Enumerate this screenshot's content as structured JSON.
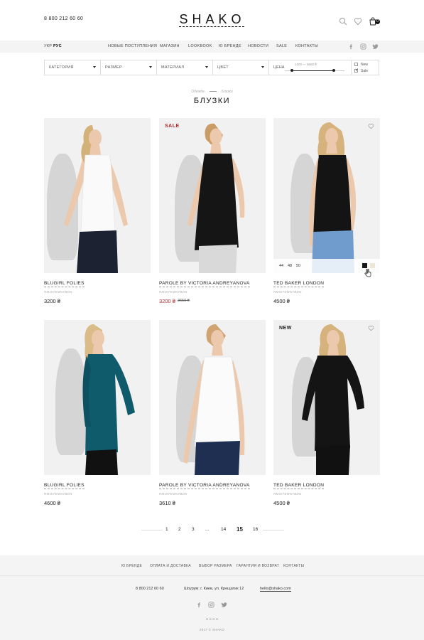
{
  "header": {
    "phone": "8 800 212 60 60",
    "logo": "SHAKO",
    "cart_count": "0"
  },
  "nav": {
    "langs": [
      "УКР",
      "РУС"
    ],
    "items": [
      "НОВЫЕ ПОСТУПЛЕНИЯ",
      "МАГАЗИН",
      "LOOKBOOK",
      "Ю БРЕНДЕ",
      "НОВОСТИ",
      "SALE",
      "КОНТАКТЫ"
    ]
  },
  "filters": {
    "category": "КАТЕГОРИЯ",
    "size": "РАЗМЕР",
    "material": "МАТЕРИАЛ",
    "color": "ЦВЕТ",
    "price_label": "ЦЕНА",
    "price_range": "1200 — 5600 ₴",
    "price_slider": {
      "min_fraction": 0.12,
      "max_fraction": 0.82
    },
    "new_label": "New",
    "new_checked": false,
    "sale_label": "Sale",
    "sale_checked": true
  },
  "breadcrumb": [
    "Одежда",
    "Блузки"
  ],
  "page_title": "БЛУЗКИ",
  "products": [
    {
      "brand": "BLUGIRL FOLIES",
      "sku": "RMISTEMN7BDN",
      "price": "3200 ₴",
      "old_price": "",
      "badge": ""
    },
    {
      "brand": "PAROLE BY VICTORIA ANDREYANOVA",
      "sku": "RMISTEMN7BDN",
      "price": "3200 ₴",
      "old_price": "3650 ₴",
      "badge": "SALE"
    },
    {
      "brand": "TED BAKER LONDON",
      "sku": "RMISTEMN7BDN",
      "price": "4500 ₴",
      "old_price": "",
      "badge": ""
    },
    {
      "brand": "BLUGIRL FOLIES",
      "sku": "RMISTEMN7BDN",
      "price": "4600 ₴",
      "old_price": "",
      "badge": ""
    },
    {
      "brand": "PAROLE BY VICTORIA ANDREYANOVA",
      "sku": "RMISTEMN7BDN",
      "price": "3610 ₴",
      "old_price": "",
      "badge": ""
    },
    {
      "brand": "TED BAKER LONDON",
      "sku": "RMISTEMN7BDN",
      "price": "4500 ₴",
      "old_price": "",
      "badge": "NEW"
    }
  ],
  "quick_sizes": [
    "44",
    "48",
    "50"
  ],
  "colors": {
    "swatch_black": "#1a1a1a",
    "swatch_cream": "#efe6d6",
    "sale_red": "#b32a2a",
    "teal_blouse": "#0f5a6b"
  },
  "pagination": [
    "1",
    "2",
    "3",
    "...",
    "14",
    "15",
    "16"
  ],
  "pagination_current": "15",
  "footer": {
    "nav": [
      "Ю БРЕНДЕ",
      "ОПЛАТА И ДОСТАВКА",
      "ВЫБОР РАЗМЕРА",
      "ГАРАНТИЯ И ВОЗВРАТ",
      "КОНТАКТЫ"
    ],
    "phone": "8 800 212 60 60",
    "address": "Шоурум: г. Киев, ул. Крещатик 12",
    "email": "hello@shako.com",
    "copyright": "2017 © SHAKO"
  },
  "icons": [
    "search-icon",
    "heart-icon",
    "cart-icon",
    "facebook-icon",
    "instagram-icon",
    "twitter-icon",
    "cursor-icon"
  ]
}
